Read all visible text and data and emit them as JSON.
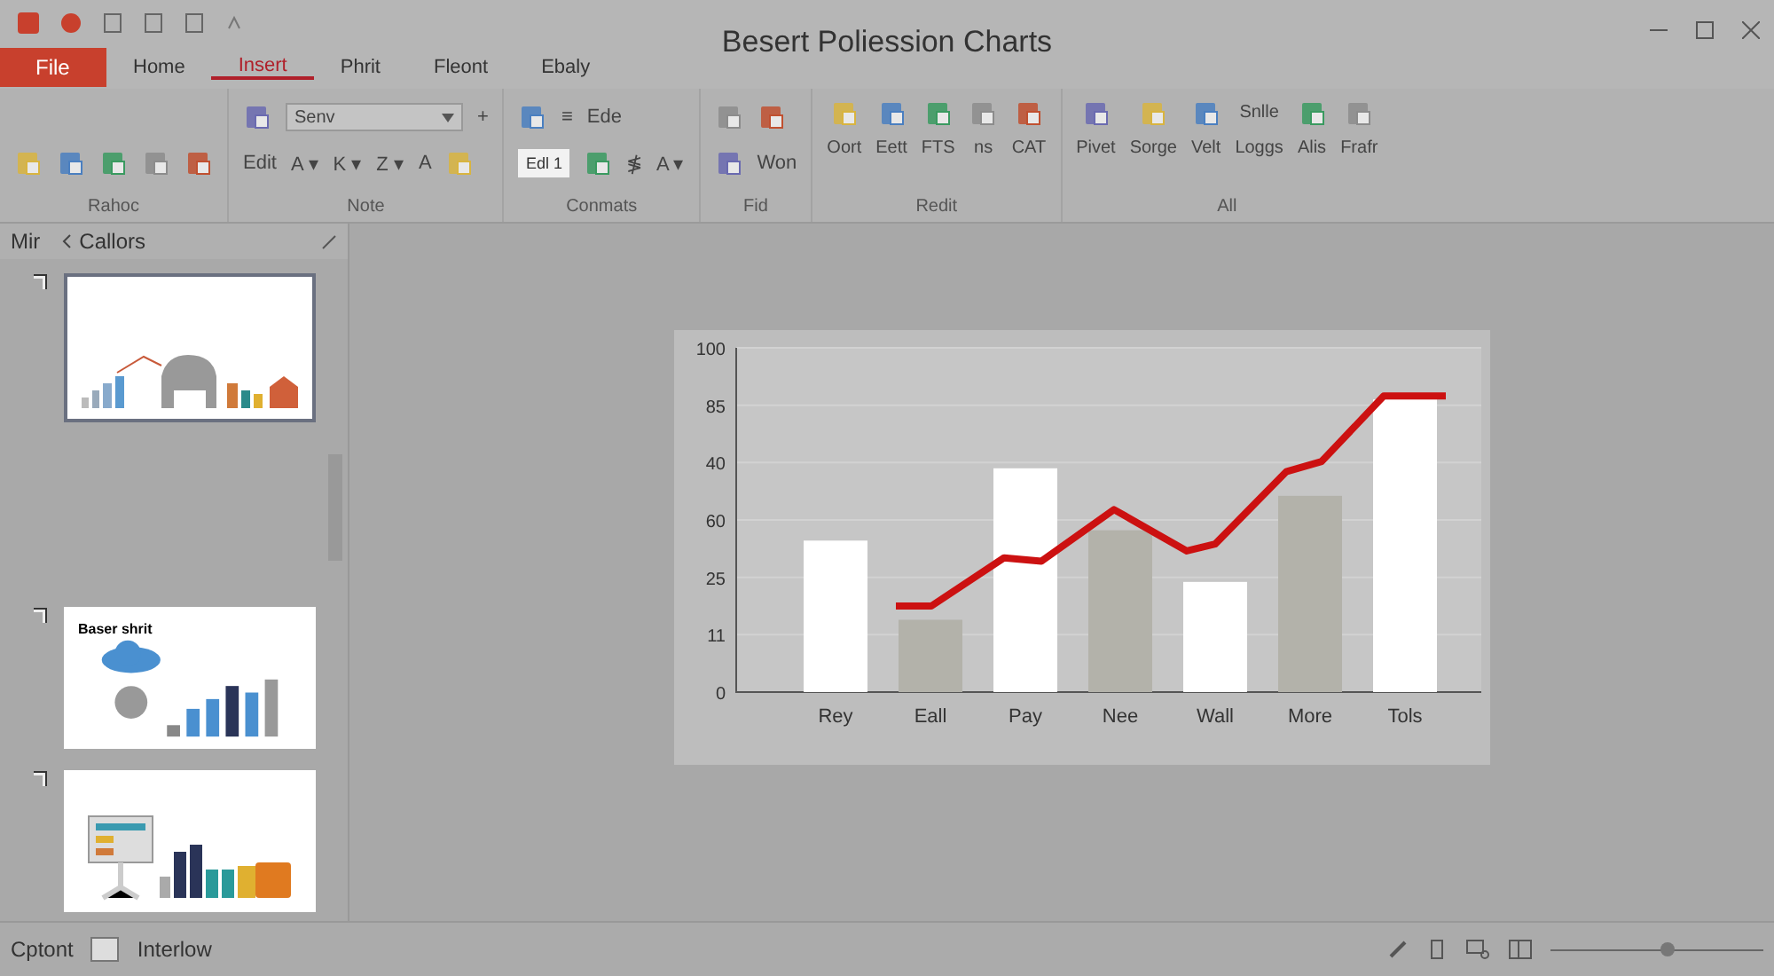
{
  "window": {
    "title": "Besert Poliession Charts"
  },
  "tabs": [
    {
      "label": "File",
      "kind": "file",
      "selected": false
    },
    {
      "label": "Home",
      "kind": "tab",
      "selected": false
    },
    {
      "label": "Insert",
      "kind": "tab",
      "selected": true
    },
    {
      "label": "Phrit",
      "kind": "tab",
      "selected": false
    },
    {
      "label": "Fleont",
      "kind": "tab",
      "selected": false
    },
    {
      "label": "Ebaly",
      "kind": "tab",
      "selected": false
    }
  ],
  "ribbon": {
    "groups": [
      {
        "label": "Rahoc",
        "kind": "rows",
        "row2": [
          {
            "kind": "icon"
          },
          {
            "kind": "icon"
          },
          {
            "kind": "icon"
          },
          {
            "kind": "icon"
          },
          {
            "kind": "icon"
          }
        ]
      },
      {
        "label": "Note",
        "kind": "rows",
        "row1": [
          {
            "kind": "icon"
          },
          {
            "kind": "combo",
            "value": "Senv"
          },
          {
            "kind": "text",
            "label": "+"
          }
        ],
        "row2": [
          {
            "kind": "text",
            "label": "Edit"
          },
          {
            "kind": "text",
            "label": "A ▾"
          },
          {
            "kind": "text",
            "label": "K ▾"
          },
          {
            "kind": "text",
            "label": "Z ▾"
          },
          {
            "kind": "text",
            "label": "A"
          },
          {
            "kind": "icon"
          }
        ]
      },
      {
        "label": "Conmats",
        "kind": "rows",
        "row1": [
          {
            "kind": "icon"
          },
          {
            "kind": "text",
            "label": "≡"
          },
          {
            "kind": "text",
            "label": "Ede"
          }
        ],
        "row2": [
          {
            "kind": "field",
            "value": "Edl 1"
          },
          {
            "kind": "icon"
          },
          {
            "kind": "text",
            "label": "≸"
          },
          {
            "kind": "text",
            "label": "A ▾"
          }
        ]
      },
      {
        "label": "Fid",
        "kind": "rows",
        "row1": [
          {
            "kind": "icon"
          },
          {
            "kind": "icon"
          }
        ],
        "row2": [
          {
            "kind": "icon"
          },
          {
            "kind": "text",
            "label": "Won"
          }
        ]
      },
      {
        "label": "Redit",
        "kind": "tools",
        "items": [
          {
            "label": "Oort"
          },
          {
            "label": "Eett"
          },
          {
            "label": "FTS"
          },
          {
            "label": "ns"
          },
          {
            "label": "CAT"
          }
        ]
      },
      {
        "label": "All",
        "kind": "tools",
        "items": [
          {
            "label": "Pivet"
          },
          {
            "label": "Sorge"
          },
          {
            "label": "Velt"
          },
          {
            "label": "Loggs",
            "top": "Snlle"
          },
          {
            "label": "Alis"
          },
          {
            "label": "Frafr"
          }
        ]
      }
    ]
  },
  "slide_panel": {
    "label": "Mir",
    "title": "Callors",
    "slides": [
      {
        "selected": true
      },
      {
        "selected": false,
        "title": "Baser shrit"
      },
      {
        "selected": false
      }
    ]
  },
  "chart": {
    "y_axis_labels": [
      "100",
      "85",
      "40",
      "60",
      "25",
      "11",
      "0"
    ],
    "x_axis_labels": [
      "Rey",
      "Eall",
      "Pay",
      "Nee",
      "Wall",
      "More",
      "Tols"
    ]
  },
  "status_bar": {
    "left": "Cptont",
    "right": "Interlow",
    "zoom": {
      "level": 0.55
    }
  }
}
